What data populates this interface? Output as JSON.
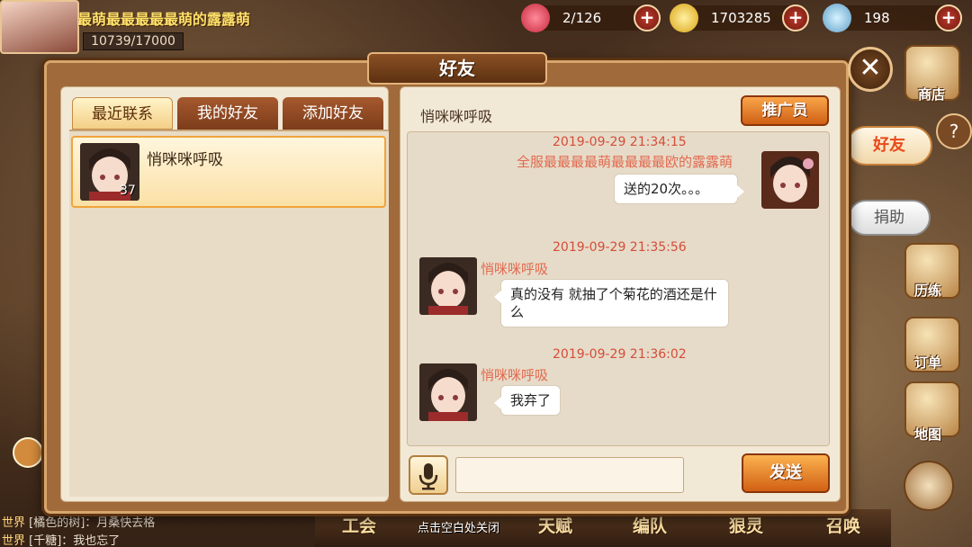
{
  "hud": {
    "player_name": "最萌最最最最最萌的露露萌",
    "hp": "10739/17000",
    "hearts": "2/126",
    "coins": "1703285",
    "gems": "198"
  },
  "side_icons": {
    "shop": "商店",
    "friends": "好友",
    "donate": "捐助",
    "training": "历练",
    "orders": "订单",
    "map": "地图"
  },
  "bottom": {
    "guild": "工会",
    "talent": "天赋",
    "formation": "编队",
    "spirit": "狠灵",
    "summon": "召唤",
    "chat": [
      {
        "channel": "世界",
        "text": "[橘色的树]：月桑快去格"
      },
      {
        "channel": "世界",
        "text": "[千糖]：我也忘了"
      }
    ],
    "close_hint": "点击空白处关闭"
  },
  "dialog": {
    "title": "好友",
    "tabs": [
      "最近联系",
      "我的好友",
      "添加好友"
    ],
    "active_tab": 0
  },
  "contacts": [
    {
      "name": "悄咪咪呼吸",
      "level": "37"
    }
  ],
  "chat": {
    "partner": "悄咪咪呼吸",
    "promo_button": "推广员",
    "messages": [
      {
        "time": "2019-09-29 21:34:15",
        "sender": "全服最最最最萌最最最最欧的露露萌",
        "text": "送的20次。。。",
        "side": "right"
      },
      {
        "time": "2019-09-29 21:35:56",
        "sender": "悄咪咪呼吸",
        "text": "真的没有 就抽了个菊花的酒还是什么",
        "side": "left"
      },
      {
        "time": "2019-09-29 21:36:02",
        "sender": "悄咪咪呼吸",
        "text": "我弃了",
        "side": "left"
      }
    ],
    "input_value": "",
    "send_button": "发送"
  },
  "colors": {
    "accent_orange": "#e07420",
    "timestamp_red": "#d44d3a",
    "panel_bg": "#f2e8d6"
  }
}
